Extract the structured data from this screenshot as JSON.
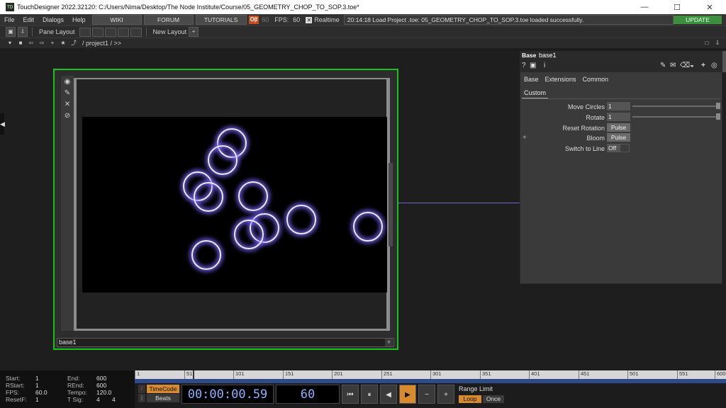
{
  "window": {
    "title": "TouchDesigner 2022.32120: C:/Users/Nima/Desktop/The Node Institute/Course/05_GEOMETRY_CHOP_TO_SOP.3.toe*",
    "app_icon": "TD",
    "minimize": "—",
    "maximize": "☐",
    "close": "✕"
  },
  "menubar": {
    "items": [
      "File",
      "Edit",
      "Dialogs",
      "Help"
    ],
    "wiki": "WIKI",
    "forum": "FORUM",
    "tutorials": "TUTORIALS",
    "toggle": "O|I",
    "fps_cap": "60",
    "fps_label": "FPS:",
    "fps_value": "60",
    "realtime": "Realtime",
    "message": "20:14:18 Load Project .toe: 05_GEOMETRY_CHOP_TO_SOP.3.toe loaded successfully.",
    "update": "UPDATE"
  },
  "toolbar": {
    "pane_layout": "Pane Layout",
    "new_layout": "New Layout",
    "new_layout_plus": "+",
    "path": "/ project1 / >>"
  },
  "node": {
    "name": "base1"
  },
  "params": {
    "op_type": "Base",
    "op_name": "base1",
    "tabs": [
      "Base",
      "Extensions",
      "Common"
    ],
    "active_tab": "Custom",
    "rows": [
      {
        "label": "Move Circles",
        "value": "1"
      },
      {
        "label": "Rotate",
        "value": "1"
      },
      {
        "label": "Reset Rotation",
        "value": "Pulse"
      },
      {
        "label": "Bloom",
        "value": "Pulse"
      },
      {
        "label": "Switch to Line",
        "value": "Off"
      }
    ]
  },
  "timeline": {
    "info": {
      "start_label": "Start:",
      "start": "1",
      "rstart_label": "RStart:",
      "rstart": "1",
      "fps_label": "FPS:",
      "fps": "60.0",
      "resetf_label": "ResetF:",
      "resetf": "1",
      "end_label": "End:",
      "end": "600",
      "rend_label": "REnd:",
      "rend": "600",
      "tempo_label": "Tempo:",
      "tempo": "120.0",
      "tsig_label": "T Sig:",
      "tsig_a": "4",
      "tsig_b": "4"
    },
    "ticks": [
      "1",
      "51",
      "101",
      "151",
      "201",
      "251",
      "301",
      "351",
      "401",
      "451",
      "501",
      "551",
      "600"
    ],
    "timecode_btn": "TimeCode",
    "beats_btn": "Beats",
    "timecode": "00:00:00.59",
    "frame": "60",
    "buttons": [
      "⏮",
      "⏸",
      "◀",
      "▶",
      "−",
      "+"
    ],
    "range_label": "Range Limit",
    "loop": "Loop",
    "once": "Once"
  }
}
